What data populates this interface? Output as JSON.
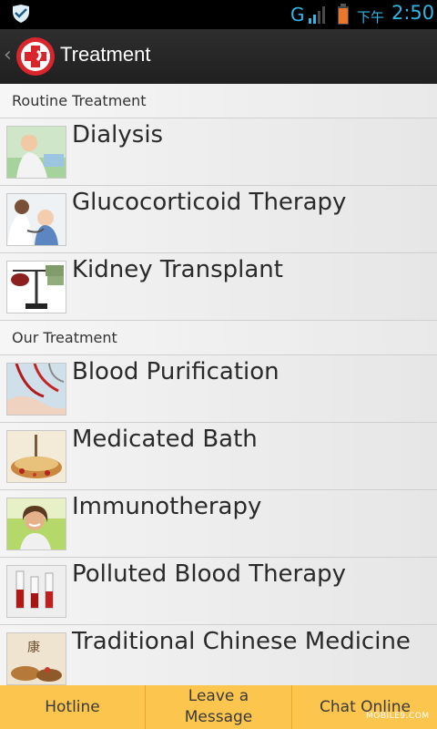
{
  "status_bar": {
    "network": "G",
    "ampm": "下午",
    "time": "2:50",
    "accent_color": "#33b5e5",
    "icons": [
      "shield-icon",
      "signal-icon",
      "battery-icon"
    ]
  },
  "action_bar": {
    "title": "Treatment",
    "icons": [
      "back-chevron-icon",
      "red-cross-logo-icon"
    ]
  },
  "sections": [
    {
      "header": "Routine Treatment",
      "items": [
        {
          "label": "Dialysis",
          "icon": "dialysis-photo"
        },
        {
          "label": "Glucocorticoid Therapy",
          "icon": "doctor-child-photo"
        },
        {
          "label": "Kidney Transplant",
          "icon": "scale-kidney-photo"
        }
      ]
    },
    {
      "header": "Our Treatment",
      "items": [
        {
          "label": "Blood Purification",
          "icon": "blood-tubing-photo"
        },
        {
          "label": "Medicated Bath",
          "icon": "bath-herbs-photo"
        },
        {
          "label": "Immunotherapy",
          "icon": "smiling-woman-photo"
        },
        {
          "label": "Polluted Blood Therapy",
          "icon": "blood-samples-photo"
        },
        {
          "label": "Traditional Chinese Medicine",
          "icon": "chinese-herbs-photo"
        }
      ]
    }
  ],
  "bottom_bar": {
    "hotline": "Hotline",
    "leave_message_line1": "Leave a",
    "leave_message_line2": "Message",
    "chat_online": "Chat Online",
    "bg_color": "#fcc54d"
  },
  "watermark": "MOBILE9.COM"
}
